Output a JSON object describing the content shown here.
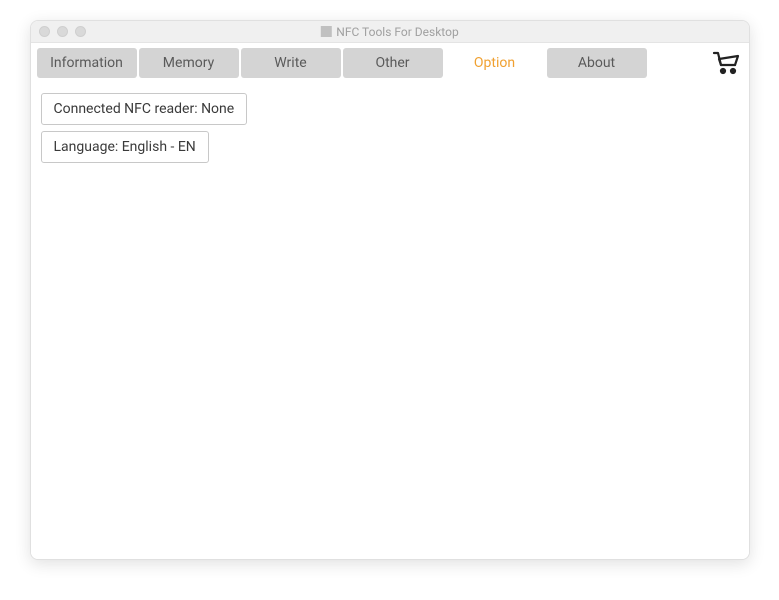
{
  "window": {
    "title": "NFC Tools For Desktop"
  },
  "tabs": {
    "information": "Information",
    "memory": "Memory",
    "write": "Write",
    "other": "Other",
    "option": "Option",
    "about": "About"
  },
  "options": {
    "nfc_reader": "Connected NFC reader: None",
    "language": "Language: English - EN"
  }
}
